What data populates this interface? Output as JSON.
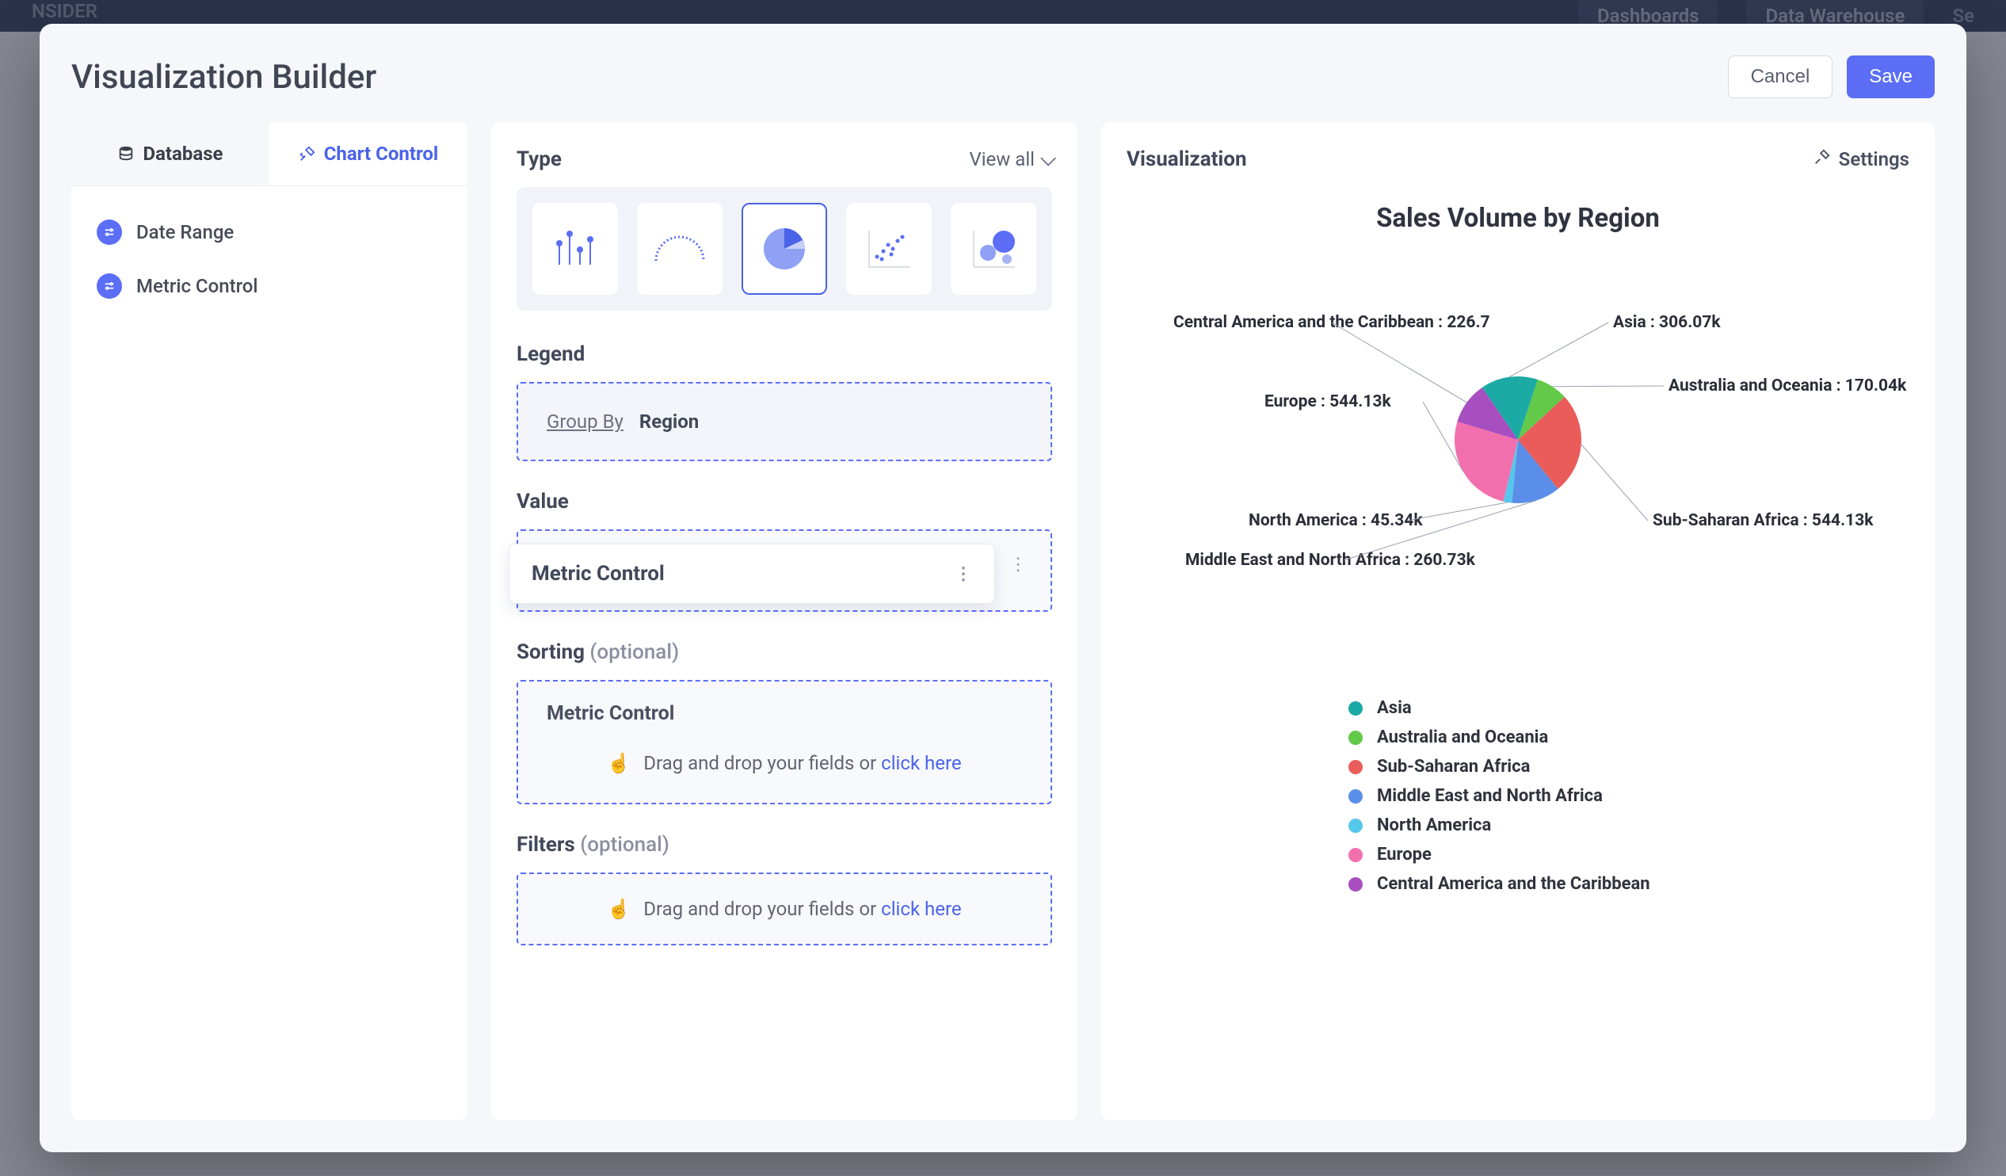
{
  "background": {
    "brand_text": "NSIDER",
    "nav": [
      "Dashboards",
      "Data Warehouse",
      "Se"
    ]
  },
  "modal": {
    "title": "Visualization Builder",
    "cancel": "Cancel",
    "save": "Save"
  },
  "left_panel": {
    "tabs": {
      "database": "Database",
      "chart_control": "Chart Control"
    },
    "items": [
      {
        "label": "Date Range"
      },
      {
        "label": "Metric Control"
      }
    ]
  },
  "mid_panel": {
    "type_label": "Type",
    "view_all": "View all",
    "chart_types": [
      "lollipop",
      "gauge",
      "pie",
      "scatter",
      "bubble"
    ],
    "selected_type_index": 2,
    "legend_label": "Legend",
    "legend_groupby": "Group By",
    "legend_field": "Region",
    "value_label": "Value",
    "value_chip": "Metric Control",
    "value_ghost": "Metric Control",
    "sorting_label": "Sorting",
    "sorting_opt": "(optional)",
    "sorting_title": "Metric Control",
    "filters_label": "Filters",
    "filters_opt": "(optional)",
    "drop_hint_prefix": "Drag and drop your fields or ",
    "drop_hint_link": "click here"
  },
  "right_panel": {
    "heading": "Visualization",
    "settings": "Settings",
    "chart_title": "Sales Volume by Region"
  },
  "chart_data": {
    "type": "pie",
    "title": "Sales Volume by Region",
    "series": [
      {
        "name": "Asia",
        "value": 306.07,
        "display": "306.07k",
        "color": "#1caaa5"
      },
      {
        "name": "Australia and Oceania",
        "value": 170.04,
        "display": "170.04k",
        "color": "#62c949"
      },
      {
        "name": "Sub-Saharan Africa",
        "value": 544.13,
        "display": "544.13k",
        "color": "#ea5c59"
      },
      {
        "name": "Middle East and North Africa",
        "value": 260.73,
        "display": "260.73k",
        "color": "#5b8ee8"
      },
      {
        "name": "North America",
        "value": 45.34,
        "display": "45.34k",
        "color": "#55c7ea"
      },
      {
        "name": "Europe",
        "value": 544.13,
        "display": "544.13k",
        "color": "#f26fad"
      },
      {
        "name": "Central America and the Caribbean",
        "value": 226.7,
        "display": "226.7",
        "color": "#a74ec0"
      }
    ],
    "legend_order": [
      "Asia",
      "Australia and Oceania",
      "Sub-Saharan Africa",
      "Middle East and North Africa",
      "North America",
      "Europe",
      "Central America and the Caribbean"
    ]
  }
}
